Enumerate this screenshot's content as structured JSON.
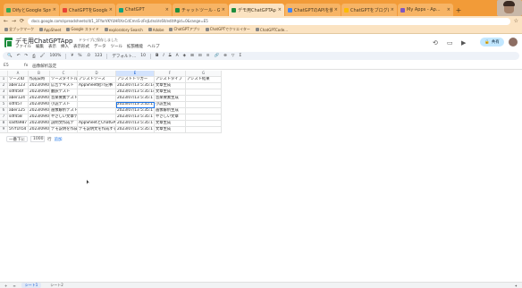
{
  "browser": {
    "tabs": [
      {
        "title": "DifyとGoogle Spreadsheet"
      },
      {
        "title": "ChatGPTをGoogle..."
      },
      {
        "title": "ChatGPT"
      },
      {
        "title": "チャットツール - Google ..."
      },
      {
        "title": "デモ用ChatGPTApp - Goo..."
      },
      {
        "title": "ChatGPTのAPIを使ったア..."
      },
      {
        "title": "ChatGPTをブログに..."
      },
      {
        "title": "My Apps - Ap..."
      }
    ],
    "active_tab_index": 4,
    "url": "docs.google.com/spreadsheets/d/1_3FYorVKYUHRXnCdCmnS-zFeJLdnaVs6ll/edit#gid=0&range=E5",
    "bookmarks": [
      "全ブックマーク",
      "AppSheet",
      "Google スライド",
      "exploratory Search",
      "Adobe",
      "ChatGPTアプリ",
      "ChatGPTでクリエイター",
      "ChatGPTCode..."
    ],
    "colors": {
      "tabbar": "#f29b38",
      "accent": "#1a73e8"
    }
  },
  "sheet": {
    "title": "デモ用ChatGPTApp",
    "subtitle": "ドライブに保存しました",
    "menus": [
      "ファイル",
      "編集",
      "表示",
      "挿入",
      "表示形式",
      "データ",
      "ツール",
      "拡張機能",
      "ヘルプ"
    ],
    "share_label": "共有",
    "zoom": "100%",
    "font": "デフォルト...",
    "font_size": "10",
    "cell_ref": "E5",
    "formula": "画像解析設定",
    "columns": [
      "A",
      "B",
      "C",
      "D",
      "E",
      "F",
      "G"
    ],
    "rows": [
      {
        "n": "1",
        "cells": [
          "ソースID",
          "作成日時",
          "ソースタイトル",
          "アシストソース",
          "アシストトリガー",
          "アシストタイプ",
          "アシスト結果"
        ]
      },
      {
        "n": "2",
        "cells": [
          "aber123",
          "2023/09/05",
          "広告テキスト",
          "AppSheet紹介記事",
          "2023/07/13 5:35:14",
          "文章生成",
          ""
        ]
      },
      {
        "n": "3",
        "cells": [
          "sdf456f",
          "2023/09/06",
          "翻訳テスト",
          "",
          "2023/07/13 5:35:14",
          "文章生成",
          ""
        ]
      },
      {
        "n": "4",
        "cells": [
          "aber124",
          "2023/09/06",
          "音楽要素テスト",
          "",
          "2023/07/13 5:35:1",
          "音楽要素生成",
          ""
        ]
      },
      {
        "n": "5",
        "cells": [
          "sdf457",
          "2023/09/06",
          "小説テスト",
          "",
          "2023/07/13 5:35:1",
          "小説生成",
          ""
        ]
      },
      {
        "n": "6",
        "cells": [
          "aber125",
          "2023/09/06",
          "画像解析テスト",
          "",
          "2023/07/13 5:35:1",
          "画像解析生成",
          ""
        ]
      },
      {
        "n": "7",
        "cells": [
          "sdf458",
          "2023/09/06",
          "やさしい文章テ",
          "",
          "2023/07/13 5:35:1",
          "やさしい文章",
          ""
        ]
      },
      {
        "n": "8",
        "cells": [
          "sadfa987",
          "2023/09/06",
          "説明文作成テ",
          "AppSheetとChatGPTで",
          "2023/07/13 5:35:1",
          "文章生成",
          ""
        ]
      },
      {
        "n": "9",
        "cells": [
          "5f7f1h54",
          "2023/09/06",
          "デモ説明を作成",
          "デモ説明文を作成する",
          "2023/07/13 5:35:1",
          "文章生成",
          ""
        ]
      }
    ],
    "add_rows": {
      "button": "一番下に",
      "count": "1000",
      "suffix": "行",
      "link": "追加"
    },
    "sheet_tabs": [
      "シート1",
      "シート2"
    ]
  }
}
